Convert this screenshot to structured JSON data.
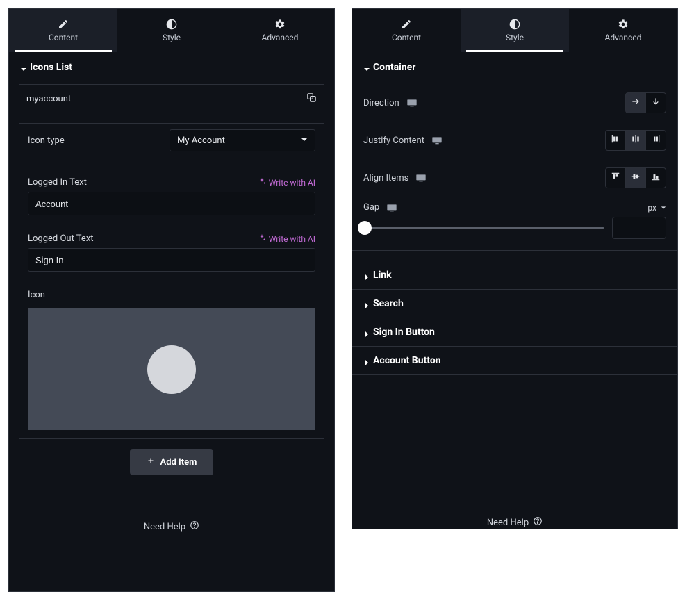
{
  "tabs": {
    "content": "Content",
    "style": "Style",
    "advanced": "Advanced"
  },
  "left": {
    "active_tab": "content",
    "section_title": "Icons List",
    "item": {
      "name": "myaccount",
      "icon_type_label": "Icon type",
      "icon_type_value": "My Account",
      "logged_in_label": "Logged In Text",
      "logged_in_value": "Account",
      "logged_out_label": "Logged Out Text",
      "logged_out_value": "Sign In",
      "icon_label": "Icon",
      "write_ai": "Write with AI"
    },
    "add_item": "Add Item",
    "need_help": "Need Help"
  },
  "right": {
    "active_tab": "style",
    "container_title": "Container",
    "controls": {
      "direction": "Direction",
      "justify": "Justify Content",
      "align": "Align Items",
      "gap": "Gap",
      "unit": "px"
    },
    "sections": {
      "link": "Link",
      "search": "Search",
      "sign_in": "Sign In Button",
      "account": "Account Button"
    },
    "need_help": "Need Help"
  }
}
